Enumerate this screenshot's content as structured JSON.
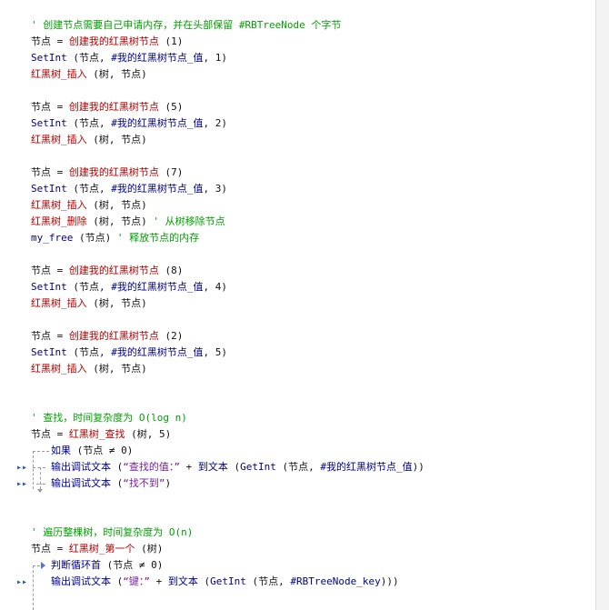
{
  "code": {
    "l01": "' 创建节点需要自己申请内存，并在头部保留 #RBTreeNode 个字节",
    "l02": [
      "节点",
      " = ",
      "创建我的红黑树节点",
      " (1)"
    ],
    "l03": [
      "SetInt",
      " (节点, ",
      "#我的红黑树节点_值",
      ", 1)"
    ],
    "l04": [
      "红黑树_插入",
      " (树, 节点)"
    ],
    "l05": [
      "节点",
      " = ",
      "创建我的红黑树节点",
      " (5)"
    ],
    "l06": [
      "SetInt",
      " (节点, ",
      "#我的红黑树节点_值",
      ", 2)"
    ],
    "l07": [
      "红黑树_插入",
      " (树, 节点)"
    ],
    "l08": [
      "节点",
      " = ",
      "创建我的红黑树节点",
      " (7)"
    ],
    "l09": [
      "SetInt",
      " (节点, ",
      "#我的红黑树节点_值",
      ", 3)"
    ],
    "l10": [
      "红黑树_插入",
      " (树, 节点)"
    ],
    "l11": [
      "红黑树_删除",
      " (树, 节点) ",
      "' 从树移除节点"
    ],
    "l12": [
      "my_free",
      " (节点) ",
      "' 释放节点的内存"
    ],
    "l13": [
      "节点",
      " = ",
      "创建我的红黑树节点",
      " (8)"
    ],
    "l14": [
      "SetInt",
      " (节点, ",
      "#我的红黑树节点_值",
      ", 4)"
    ],
    "l15": [
      "红黑树_插入",
      " (树, 节点)"
    ],
    "l16": [
      "节点",
      " = ",
      "创建我的红黑树节点",
      " (2)"
    ],
    "l17": [
      "SetInt",
      " (节点, ",
      "#我的红黑树节点_值",
      ", 5)"
    ],
    "l18": [
      "红黑树_插入",
      " (树, 节点)"
    ],
    "l19": "' 查找，时间复杂度为 O(log n)",
    "l20": [
      "节点",
      " = ",
      "红黑树_查找",
      " (树, 5)"
    ],
    "l21": [
      "如果",
      " (节点 ≠ 0)"
    ],
    "l22": [
      "输出调试文本",
      " (",
      "“查找的值：”",
      " + ",
      "到文本",
      " (",
      "GetInt",
      " (节点, ",
      "#我的红黑树节点_值",
      "))"
    ],
    "l23": [
      "输出调试文本",
      " (",
      "“找不到”",
      ")"
    ],
    "l24": "' 遍历整棵树，时间复杂度为 O(n)",
    "l25": [
      "节点",
      " = ",
      "红黑树_第一个",
      " (树)"
    ],
    "l26": [
      "判断循环首",
      " (节点 ≠ 0)"
    ],
    "l27": [
      "输出调试文本",
      " (",
      "“键：”",
      " + ",
      "到文本",
      " (",
      "GetInt",
      " (节点, ",
      "#RBTreeNode_key",
      ")))"
    ]
  },
  "icons": {
    "breakpoint_marker": "double-right-arrow-icon",
    "loop_marker": "right-arrow-icon"
  }
}
